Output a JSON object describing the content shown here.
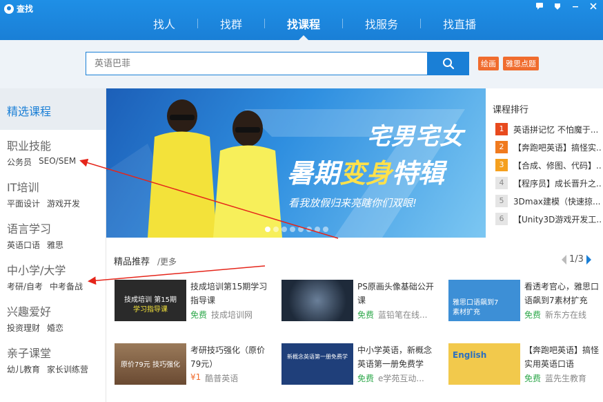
{
  "app": {
    "title": "查找"
  },
  "nav": {
    "tabs": [
      {
        "label": "找人"
      },
      {
        "label": "找群"
      },
      {
        "label": "找课程"
      },
      {
        "label": "找服务"
      },
      {
        "label": "找直播"
      }
    ],
    "active": "找课程"
  },
  "search": {
    "placeholder": "英语巴菲",
    "tags": [
      "绘画",
      "雅思点题"
    ]
  },
  "sidebar": {
    "featured": "精选课程",
    "categories": [
      {
        "title": "职业技能",
        "subs": [
          "公务员",
          "SEO/SEM"
        ]
      },
      {
        "title": "IT培训",
        "subs": [
          "平面设计",
          "游戏开发"
        ]
      },
      {
        "title": "语言学习",
        "subs": [
          "英语口语",
          "雅思"
        ]
      },
      {
        "title": "中小学/大学",
        "subs": [
          "考研/自考",
          "中考备战"
        ]
      },
      {
        "title": "兴趣爱好",
        "subs": [
          "投资理财",
          "婚恋"
        ]
      },
      {
        "title": "亲子课堂",
        "subs": [
          "幼儿教育",
          "家长训练营"
        ]
      }
    ]
  },
  "banner": {
    "line1": "宅男宅女",
    "line2a": "暑期",
    "line2b": "变身",
    "line2c": "特辑",
    "slogan": "看我放假归来亮瞎你们双眼!",
    "slides": 8,
    "active_slide": 0
  },
  "ranking": {
    "title": "课程排行",
    "items": [
      {
        "rank": "1",
        "text": "英语拼记忆 不怕魔于..."
      },
      {
        "rank": "2",
        "text": "【奔跑吧英语】搞怪实..."
      },
      {
        "rank": "3",
        "text": "【合成、修图、代码】..."
      },
      {
        "rank": "4",
        "text": "【程序员】成长晋升之..."
      },
      {
        "rank": "5",
        "text": "3Dmax建模（快速掠..."
      },
      {
        "rank": "6",
        "text": "【Unity3D游戏开发工..."
      }
    ],
    "colors": [
      "#e84a1e",
      "#f07a1e",
      "#f5a01e"
    ]
  },
  "recommend": {
    "title": "精品推荐",
    "more": "/更多",
    "page": "1/3",
    "courses": [
      {
        "name": "技成培训第15期学习指导课",
        "price": "免费",
        "provider": "技成培训网",
        "thumb_line1": "技成培训 第15期",
        "thumb_line2": "学习指导课",
        "thumb_color": "#2a2a2a"
      },
      {
        "name": "PS原画头像基础公开课",
        "price": "免费",
        "provider": "蓝铅笔在线...",
        "thumb_line1": "",
        "thumb_line2": "",
        "thumb_color": "#1e2a3a"
      },
      {
        "name": "看透考官心，雅思口语飙到7素材扩充",
        "price": "免费",
        "provider": "新东方在线",
        "thumb_line1": "雅思口语飙到7",
        "thumb_line2": "素材扩充",
        "thumb_color": "#3d8fd6"
      },
      {
        "name": "考研技巧强化（原价79元）",
        "price": "¥1",
        "provider": "酷普英语",
        "thumb_line1": "原价79元 技巧强化",
        "thumb_line2": "",
        "thumb_color": "#8a6a4a"
      },
      {
        "name": "中小学英语，新概念英语第一册免费学",
        "price": "免费",
        "provider": "e学苑互动...",
        "thumb_line1": "新概念英语第一册免费学",
        "thumb_line2": "",
        "thumb_color": "#1f3f7a"
      },
      {
        "name": "【奔跑吧英语】搞怪实用英语口语",
        "price": "免费",
        "provider": "蓝先生教育",
        "thumb_line1": "English",
        "thumb_line2": "",
        "thumb_color": "#f2c94c"
      }
    ]
  }
}
